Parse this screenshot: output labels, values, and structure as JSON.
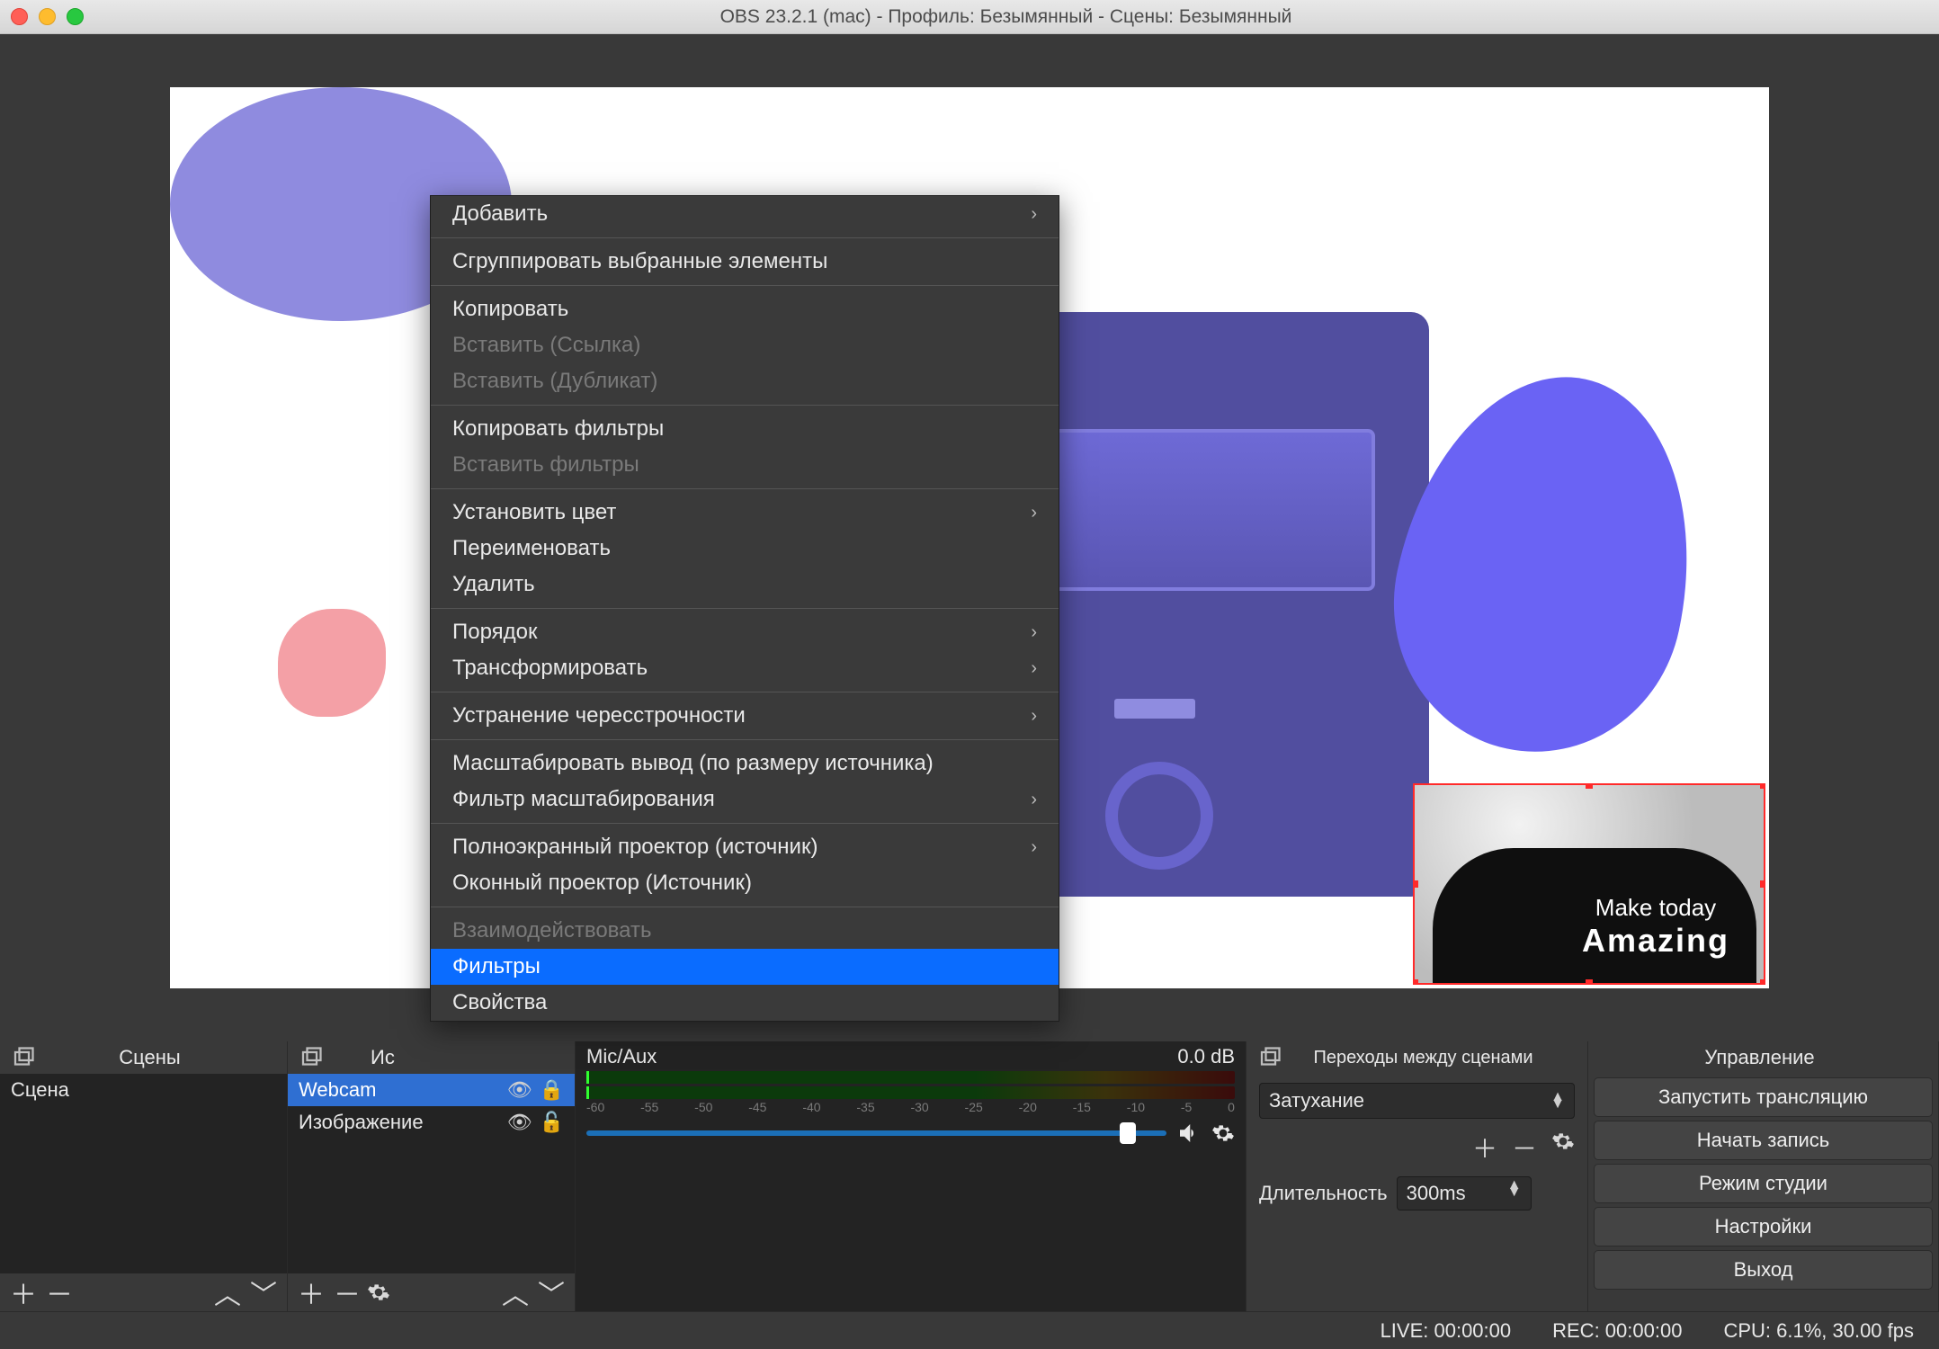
{
  "title": "OBS 23.2.1 (mac) - Профиль: Безымянный - Сцены: Безымянный",
  "webcam_text": {
    "line1": "Make today",
    "line2": "Amazing"
  },
  "context_menu": {
    "add": "Добавить",
    "group": "Сгруппировать выбранные элементы",
    "copy": "Копировать",
    "paste_ref": "Вставить (Ссылка)",
    "paste_dup": "Вставить (Дубликат)",
    "copy_filters": "Копировать фильтры",
    "paste_filters": "Вставить фильтры",
    "set_color": "Установить цвет",
    "rename": "Переименовать",
    "delete": "Удалить",
    "order": "Порядок",
    "transform": "Трансформировать",
    "deinterlace": "Устранение чересстрочности",
    "scale_output": "Масштабировать вывод (по размеру источника)",
    "scale_filter": "Фильтр масштабирования",
    "fullscreen_proj": "Полноэкранный проектор (источник)",
    "window_proj": "Оконный проектор (Источник)",
    "interact": "Взаимодействовать",
    "filters": "Фильтры",
    "properties": "Свойства"
  },
  "docks": {
    "scenes": {
      "title": "Сцены",
      "items": [
        "Сцена"
      ]
    },
    "sources": {
      "title_prefix": "Ис",
      "items": [
        {
          "name": "Webcam",
          "selected": true
        },
        {
          "name": "Изображение",
          "selected": false
        }
      ]
    },
    "mixer": {
      "channel": "Mic/Aux",
      "db": "0.0 dB",
      "ticks": [
        "-60",
        "-55",
        "-50",
        "-45",
        "-40",
        "-35",
        "-30",
        "-25",
        "-20",
        "-15",
        "-10",
        "-5",
        "0"
      ]
    },
    "transitions": {
      "title": "Переходы между сценами",
      "selected": "Затухание",
      "duration_label": "Длительность",
      "duration_value": "300ms"
    },
    "controls": {
      "title": "Управление",
      "buttons": [
        "Запустить трансляцию",
        "Начать запись",
        "Режим студии",
        "Настройки",
        "Выход"
      ]
    }
  },
  "status": {
    "live": "LIVE: 00:00:00",
    "rec": "REC: 00:00:00",
    "cpu": "CPU: 6.1%, 30.00 fps"
  }
}
